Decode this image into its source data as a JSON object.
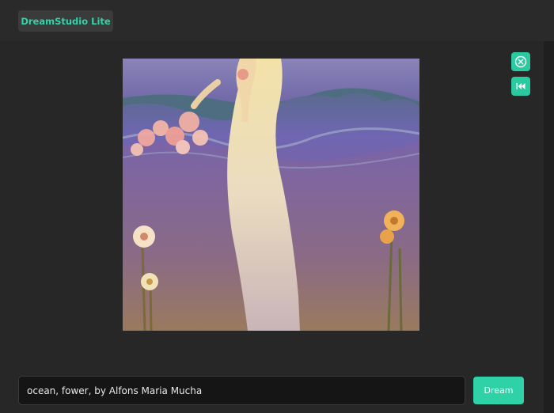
{
  "app": {
    "brand_label": "DreamStudio Lite"
  },
  "toolbar": {
    "close_icon": "close-circle-icon",
    "rewind_icon": "skip-back-icon"
  },
  "prompt": {
    "value": "ocean, fower, by Alfons Maria Mucha"
  },
  "actions": {
    "dream_label": "Dream"
  },
  "colors": {
    "accent": "#2fd1a6",
    "background": "#242424",
    "input_background": "#151515"
  }
}
